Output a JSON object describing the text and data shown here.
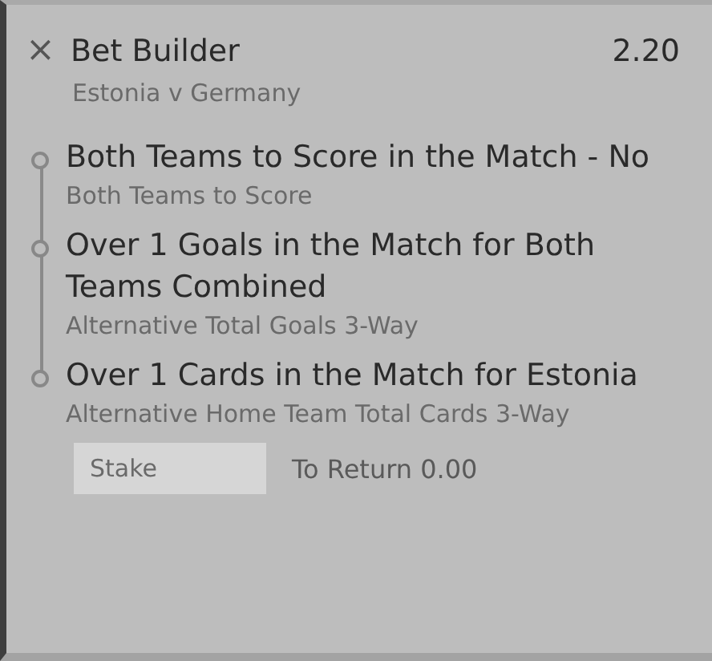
{
  "bet": {
    "close": "×",
    "title": "Bet Builder",
    "odds": "2.20",
    "event": "Estonia v Germany"
  },
  "selections": [
    {
      "name": "Both Teams to Score in the Match - No",
      "market": "Both Teams to Score"
    },
    {
      "name": "Over 1 Goals in the Match for Both Teams Combined",
      "market": "Alternative Total Goals 3-Way"
    },
    {
      "name": "Over 1 Cards in the Match for Estonia",
      "market": "Alternative Home Team Total Cards 3-Way"
    }
  ],
  "stake": {
    "placeholder": "Stake"
  },
  "to_return": "To Return 0.00"
}
